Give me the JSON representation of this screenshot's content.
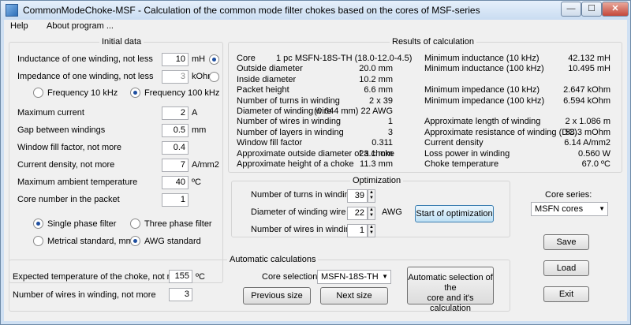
{
  "title": "CommonModeChoke-MSF  - Calculation of the common mode filter chokes based on the cores of MSF-series",
  "menu": [
    "Help",
    "About program ..."
  ],
  "initial": {
    "title": "Initial data",
    "inductance_label": "Inductance of one winding, not less",
    "inductance_value": "10",
    "inductance_unit": "mH",
    "impedance_label": "Impedance of one winding, not less",
    "impedance_value": "3",
    "impedance_unit": "kOhm",
    "freq10": "Frequency 10 kHz",
    "freq100": "Frequency 100 kHz",
    "max_current_label": "Maximum current",
    "max_current_value": "2",
    "max_current_unit": "A",
    "gap_label": "Gap between windings",
    "gap_value": "0.5",
    "gap_unit": "mm",
    "fill_label": "Window fill factor, not more",
    "fill_value": "0.4",
    "density_label": "Current density, not more",
    "density_value": "7",
    "density_unit": "A/mm2",
    "temp_label": "Maximum ambient temperature",
    "temp_value": "40",
    "temp_unit": "ºC",
    "core_num_label": "Core number in the packet",
    "core_num_value": "1",
    "single_phase": "Single phase filter",
    "three_phase": "Three phase filter",
    "metric": "Metrical standard, mm",
    "awg": "AWG standard"
  },
  "results": {
    "title": "Results of calculation",
    "left": [
      {
        "label": "Core",
        "value": "1 pc MSFN-18S-TH (18.0-12.0-4.5)"
      },
      {
        "label": "Outside diameter",
        "value": "20.0 mm"
      },
      {
        "label": "Inside diameter",
        "value": "10.2 mm"
      },
      {
        "label": "Packet height",
        "value": "6.6 mm"
      },
      {
        "label": "Number of turns in winding",
        "value": "2 x 39"
      },
      {
        "label": "Diameter of winding wire",
        "value": "(0.644 mm)     22 AWG"
      },
      {
        "label": "Number of wires in winding",
        "value": "1"
      },
      {
        "label": "Number of layers in winding",
        "value": "3"
      },
      {
        "label": "Window fill factor",
        "value": "0.311"
      },
      {
        "label": "Approximate outside diameter of a choke",
        "value": "23.1 mm"
      },
      {
        "label": "Approximate height of a choke",
        "value": "11.3 mm"
      }
    ],
    "right": [
      {
        "label": "Minimum inductance (10 kHz)",
        "value": "42.132 mH",
        "row": 0
      },
      {
        "label": "Minimum inductance (100 kHz)",
        "value": "10.495 mH",
        "row": 1
      },
      {
        "label": "Minimum impedance (10 kHz)",
        "value": "2.647 kOhm",
        "row": 3
      },
      {
        "label": "Minimum impedance (100 kHz)",
        "value": "6.594 kOhm",
        "row": 4
      },
      {
        "label": "Approximate length of winding",
        "value": "2 x 1.086 m",
        "row": 6
      },
      {
        "label": "Approximate resistance of winding (DC)",
        "value": "58.3 mOhm",
        "row": 7
      },
      {
        "label": "Current density",
        "value": "6.14 A/mm2",
        "row": 8
      },
      {
        "label": "Loss power in winding",
        "value": "0.560 W",
        "row": 9
      },
      {
        "label": "Choke temperature",
        "value": "67.0 ºC",
        "row": 10
      }
    ]
  },
  "optimization": {
    "title": "Optimization",
    "turns_label": "Number of turns in winding",
    "turns_value": "39",
    "diameter_label": "Diameter of winding wire",
    "diameter_value": "22",
    "diameter_unit": "AWG",
    "wires_label": "Number of wires in winding",
    "wires_value": "1",
    "start_button": "Start of optimization"
  },
  "core_series": {
    "label": "Core series:",
    "selected": "MSFN cores"
  },
  "auto": {
    "title": "Automatic calculations",
    "exp_temp_label": "Expected temperature of the choke, not more",
    "exp_temp_value": "155",
    "exp_temp_unit": "ºC",
    "wires_label": "Number of wires in winding, not more",
    "wires_value": "3",
    "core_sel_label": "Core selection:",
    "core_sel_value": "MSFN-18S-TH",
    "prev_button": "Previous size",
    "next_button": "Next size",
    "auto_button_line1": "Automatic selection of the",
    "auto_button_line2": "core and it's calculation"
  },
  "buttons": {
    "save": "Save",
    "load": "Load",
    "exit": "Exit"
  }
}
